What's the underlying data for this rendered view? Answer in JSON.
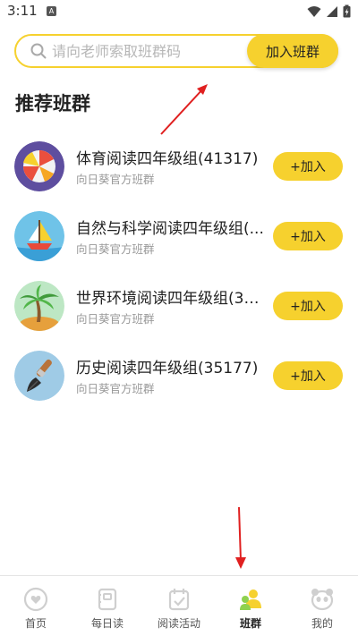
{
  "status_bar": {
    "time": "3:11",
    "notification_badge": "A"
  },
  "search": {
    "placeholder": "请向老师索取班群码",
    "join_button_label": "加入班群"
  },
  "section_title": "推荐班群",
  "groups": [
    {
      "title": "体育阅读四年级组(41317)",
      "subtitle": "向日葵官方班群",
      "button_label": "+加入",
      "icon": "beach-ball-icon"
    },
    {
      "title": "自然与科学阅读四年级组(...",
      "subtitle": "向日葵官方班群",
      "button_label": "+加入",
      "icon": "sailboat-icon"
    },
    {
      "title": "世界环境阅读四年级组(33...",
      "subtitle": "向日葵官方班群",
      "button_label": "+加入",
      "icon": "palm-tree-icon"
    },
    {
      "title": "历史阅读四年级组(35177)",
      "subtitle": "向日葵官方班群",
      "button_label": "+加入",
      "icon": "brush-icon"
    }
  ],
  "bottom_nav": [
    {
      "label": "首页",
      "icon": "home-heart-icon",
      "active": false
    },
    {
      "label": "每日读",
      "icon": "notebook-icon",
      "active": false
    },
    {
      "label": "阅读活动",
      "icon": "calendar-check-icon",
      "active": false
    },
    {
      "label": "班群",
      "icon": "class-group-icon",
      "active": true
    },
    {
      "label": "我的",
      "icon": "panda-face-icon",
      "active": false
    }
  ],
  "colors": {
    "accent": "#f6d12e",
    "arrow": "#e02020",
    "subtitle": "#999999"
  }
}
